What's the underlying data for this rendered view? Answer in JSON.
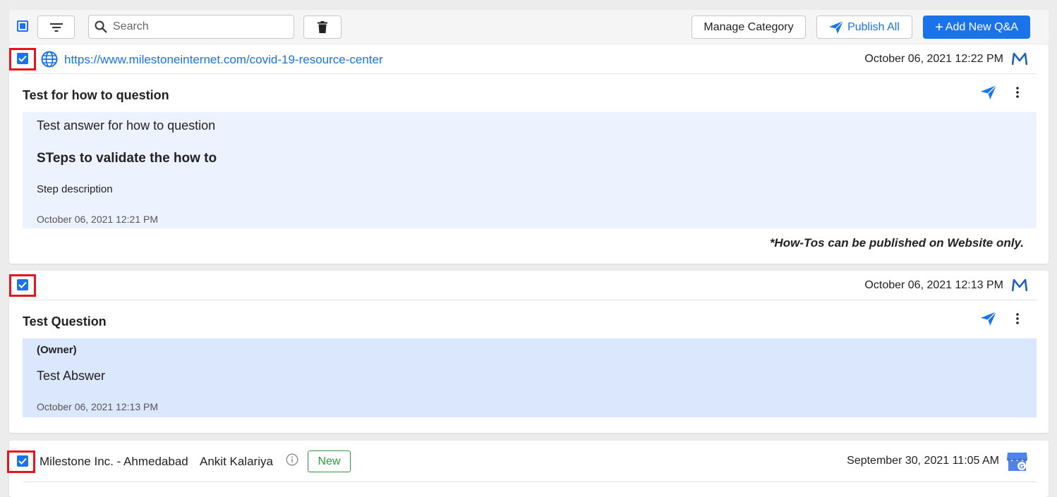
{
  "toolbar": {
    "search_placeholder": "Search",
    "manage_category_label": "Manage Category",
    "publish_all_label": "Publish All",
    "add_new_label": "Add New Q&A",
    "add_icon_glyph": "+"
  },
  "cards": [
    {
      "url": "https://www.milestoneinternet.com/covid-19-resource-center",
      "date": "October 06, 2021 12:22 PM",
      "question": "Test for how to question",
      "answer": "Test answer for how to question",
      "steps_heading": "STeps to validate the how to",
      "step_description": "Step description",
      "answer_date": "October 06, 2021 12:21 PM",
      "note": "*How-Tos can be published on Website only.",
      "source_icon": "milestone-logo-icon"
    },
    {
      "date": "October 06, 2021 12:13 PM",
      "question": "Test Question",
      "owner_label": "(Owner)",
      "answer": "Test Abswer",
      "answer_date": "October 06, 2021 12:13 PM",
      "source_icon": "milestone-logo-icon"
    },
    {
      "location": "Milestone Inc. - Ahmedabad",
      "author": "Ankit Kalariya",
      "badge": "New",
      "date": "September 30, 2021 11:05 AM",
      "source_icon": "google-my-business-icon"
    }
  ],
  "colors": {
    "accent": "#1a73e8",
    "highlight": "#e8141b",
    "answer_bg_1": "#edf3fe",
    "answer_bg_2": "#dbe7fc",
    "badge_green": "#2e9a3e"
  }
}
